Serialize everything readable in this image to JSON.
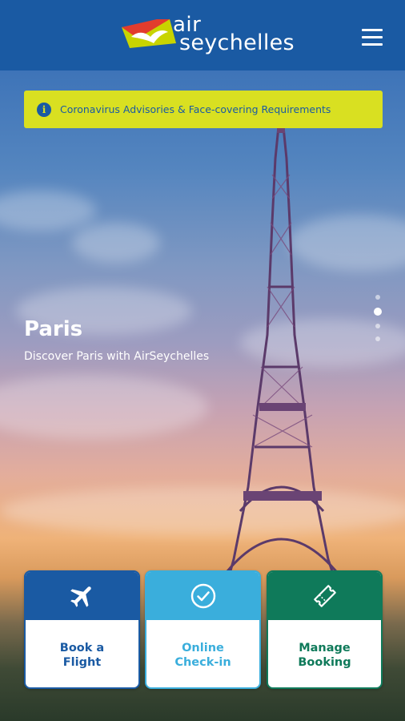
{
  "header": {
    "logo_air": "air",
    "logo_seychelles": "seychelles",
    "menu_icon": "hamburger-menu-icon"
  },
  "advisory": {
    "icon": "info-icon",
    "icon_glyph": "i",
    "text": "Coronavirus Advisories & Face-covering Requirements"
  },
  "hero": {
    "title": "Paris",
    "subtitle": "Discover Paris with AirSeychelles",
    "slides_total": 4,
    "active_slide": 2
  },
  "actions": [
    {
      "label_line1": "Book a",
      "label_line2": "Flight",
      "icon": "airplane-icon"
    },
    {
      "label_line1": "Online",
      "label_line2": "Check-in",
      "icon": "check-circle-icon"
    },
    {
      "label_line1": "Manage",
      "label_line2": "Booking",
      "icon": "ticket-icon"
    }
  ],
  "colors": {
    "brand_blue": "#1a5aa3",
    "advisory_yellow": "#d9e021",
    "checkin_cyan": "#3aaedc",
    "manage_green": "#0f7a5a"
  }
}
